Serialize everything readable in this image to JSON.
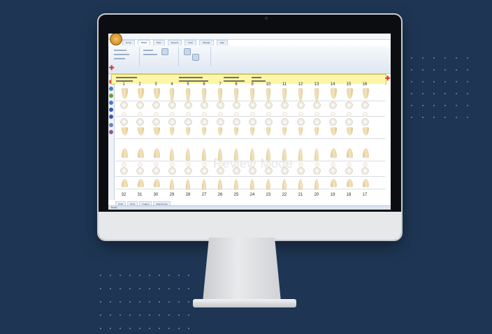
{
  "app": {
    "tabs": [
      "Home",
      "Chart",
      "Perio",
      "Reports",
      "View",
      "Settings",
      "Help"
    ],
    "active_tab": "Chart",
    "bottom_tabs": [
      "Chart",
      "Perio",
      "Images",
      "Attachments"
    ],
    "status": "Ready"
  },
  "chart": {
    "upper_teeth": [
      "1",
      "2",
      "3",
      "4",
      "5",
      "6",
      "7",
      "8",
      "9",
      "10",
      "11",
      "12",
      "13",
      "14",
      "15",
      "16"
    ],
    "lower_teeth": [
      "32",
      "31",
      "30",
      "29",
      "28",
      "27",
      "26",
      "25",
      "24",
      "23",
      "22",
      "21",
      "20",
      "19",
      "18",
      "17"
    ],
    "watermark": "Review Mode"
  },
  "colors": {
    "background": "#1e3654",
    "info_band": "#fbf6a8",
    "accent_red": "#d9362a"
  }
}
